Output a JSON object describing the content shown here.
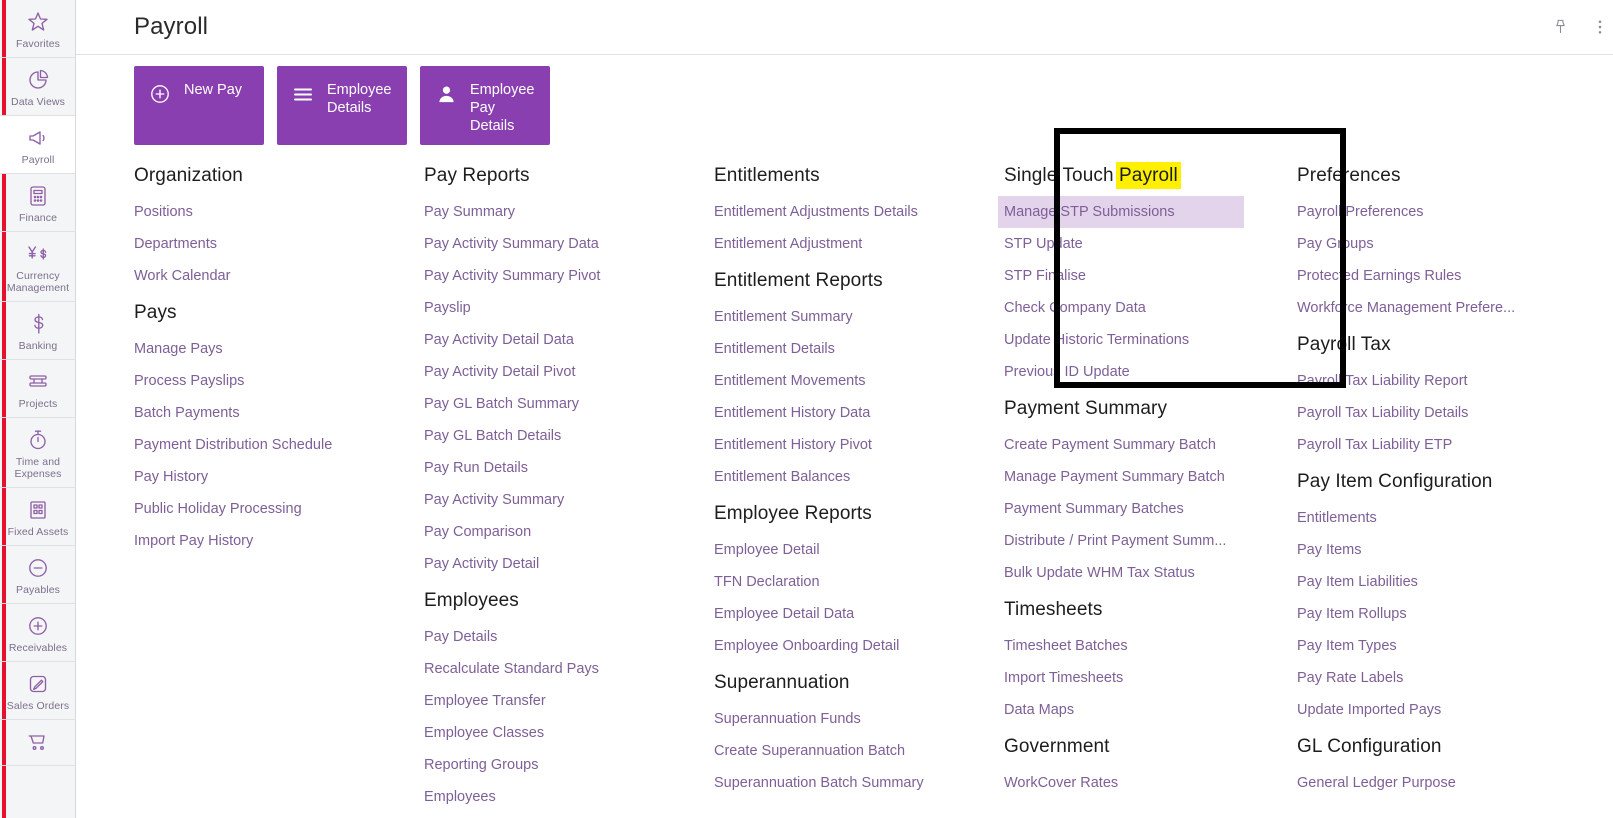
{
  "header": {
    "title": "Payroll",
    "icons": [
      {
        "name": "pin-icon",
        "glyph": "pin"
      },
      {
        "name": "more-options-icon",
        "glyph": "kebab"
      }
    ]
  },
  "sidebar": {
    "items": [
      {
        "label": "Favorites",
        "icon": "star-icon",
        "active": false
      },
      {
        "label": "Data Views",
        "icon": "pie-chart-icon",
        "active": false
      },
      {
        "label": "Payroll",
        "icon": "megaphone-icon",
        "active": true
      },
      {
        "label": "Finance",
        "icon": "calculator-icon",
        "active": false
      },
      {
        "label": "Currency Management",
        "icon": "currency-icon",
        "active": false
      },
      {
        "label": "Banking",
        "icon": "dollar-icon",
        "active": false
      },
      {
        "label": "Projects",
        "icon": "layers-icon",
        "active": false
      },
      {
        "label": "Time and Expenses",
        "icon": "stopwatch-icon",
        "active": false
      },
      {
        "label": "Fixed Assets",
        "icon": "building-icon",
        "active": false
      },
      {
        "label": "Payables",
        "icon": "minus-circle-icon",
        "active": false
      },
      {
        "label": "Receivables",
        "icon": "plus-circle-icon",
        "active": false
      },
      {
        "label": "Sales Orders",
        "icon": "pencil-box-icon",
        "active": false
      },
      {
        "label": "",
        "icon": "shopping-cart-icon",
        "active": false
      }
    ]
  },
  "actions": [
    {
      "label": "New Pay",
      "icon": "plus-circle-icon"
    },
    {
      "label": "Employee Details",
      "icon": "list-lines-icon"
    },
    {
      "label": "Employee Pay Details",
      "icon": "person-icon"
    }
  ],
  "columns": [
    {
      "groups": [
        {
          "title": "Organization",
          "links": [
            "Positions",
            "Departments",
            "Work Calendar"
          ]
        },
        {
          "title": "Pays",
          "links": [
            "Manage Pays",
            "Process Payslips",
            "Batch Payments",
            "Payment Distribution Schedule",
            "Pay History",
            "Public Holiday Processing",
            "Import Pay History"
          ]
        }
      ]
    },
    {
      "groups": [
        {
          "title": "Pay Reports",
          "links": [
            "Pay Summary",
            "Pay Activity Summary Data",
            "Pay Activity Summary Pivot",
            "Payslip",
            "Pay Activity Detail Data",
            "Pay Activity Detail Pivot",
            "Pay GL Batch Summary",
            "Pay GL Batch Details",
            "Pay Run Details",
            "Pay Activity Summary",
            "Pay Comparison",
            "Pay Activity Detail"
          ]
        },
        {
          "title": "Employees",
          "links": [
            "Pay Details",
            "Recalculate Standard Pays",
            "Employee Transfer",
            "Employee Classes",
            "Reporting Groups",
            "Employees"
          ]
        }
      ]
    },
    {
      "groups": [
        {
          "title": "Entitlements",
          "links": [
            "Entitlement Adjustments Details",
            "Entitlement Adjustment"
          ]
        },
        {
          "title": "Entitlement Reports",
          "links": [
            "Entitlement Summary",
            "Entitlement Details",
            "Entitlement Movements",
            "Entitlement History Data",
            "Entitlement History Pivot",
            "Entitlement Balances"
          ]
        },
        {
          "title": "Employee Reports",
          "links": [
            "Employee Detail",
            "TFN Declaration",
            "Employee Detail Data",
            "Employee Onboarding Detail"
          ]
        },
        {
          "title": "Superannuation",
          "links": [
            "Superannuation Funds",
            "Create Superannuation Batch",
            "Superannuation Batch Summary"
          ]
        }
      ]
    },
    {
      "groups": [
        {
          "title": "Single Touch Payroll",
          "title_prefix": "Single Touch ",
          "title_highlight": "Payroll",
          "links": [
            "Manage STP Submissions",
            "STP Update",
            "STP Finalise",
            "Check Company Data",
            "Update Historic Terminations",
            "Previous ID Update"
          ],
          "hovered_link": "Manage STP Submissions"
        },
        {
          "title": "Payment Summary",
          "links": [
            "Create Payment Summary Batch",
            "Manage Payment Summary Batch",
            "Payment Summary Batches",
            "Distribute / Print Payment Summ...",
            "Bulk Update WHM Tax Status"
          ]
        },
        {
          "title": "Timesheets",
          "links": [
            "Timesheet Batches",
            "Import Timesheets",
            "Data Maps"
          ]
        },
        {
          "title": "Government",
          "links": [
            "WorkCover Rates"
          ]
        }
      ]
    },
    {
      "groups": [
        {
          "title": "Preferences",
          "links": [
            "Payroll Preferences",
            "Pay Groups",
            "Protected Earnings Rules",
            "Workforce Management Prefere..."
          ]
        },
        {
          "title": "Payroll Tax",
          "links": [
            "Payroll Tax Liability Report",
            "Payroll Tax Liability Details",
            "Payroll Tax Liability ETP"
          ]
        },
        {
          "title": "Pay Item Configuration",
          "links": [
            "Entitlements",
            "Pay Items",
            "Pay Item Liabilities",
            "Pay Item Rollups",
            "Pay Item Types",
            "Pay Rate Labels",
            "Update Imported Pays"
          ]
        },
        {
          "title": "GL Configuration",
          "links": [
            "General Ledger Purpose"
          ]
        }
      ]
    }
  ],
  "annotation": {
    "box_name": "single-touch-payroll-highlight-box",
    "box_color": "#000000",
    "highlight_color": "#ffef00"
  },
  "colors": {
    "accent_purple": "#8a3fb0",
    "link_purple": "#7e5f96",
    "rail_bg": "#f4f5f7",
    "red_stripe": "#e8112d",
    "hover_bg": "#e3d4ec"
  }
}
